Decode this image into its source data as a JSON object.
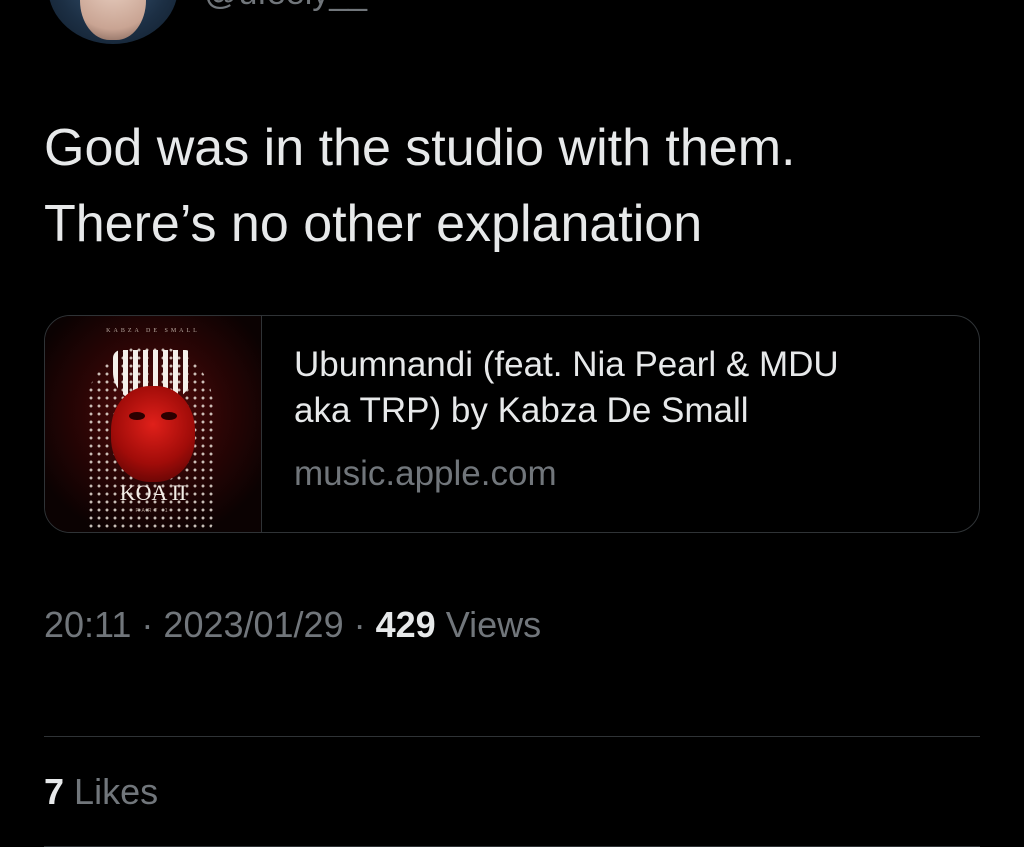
{
  "author": {
    "handle": "@ufeely__"
  },
  "tweet": {
    "text_lines": [
      "God was in the studio with them.",
      "There’s no other explanation"
    ]
  },
  "card": {
    "cover": {
      "artist_text": "KABZA DE SMALL",
      "album_title": "KOA II",
      "part_text": "PART 1"
    },
    "title_lines": [
      "Ubumnandi (feat. Nia Pearl & MDU",
      "aka TRP) by Kabza De Small"
    ],
    "domain": "music.apple.com"
  },
  "meta": {
    "time": "20:11",
    "separator": " · ",
    "date": "2023/01/29",
    "views_count": "429",
    "views_label": "Views"
  },
  "stats": {
    "likes_count": "7",
    "likes_label": "Likes"
  },
  "colors": {
    "background": "#000000",
    "primary_text": "#e7e9ea",
    "secondary_text": "#71767b",
    "border": "#2f3336"
  }
}
